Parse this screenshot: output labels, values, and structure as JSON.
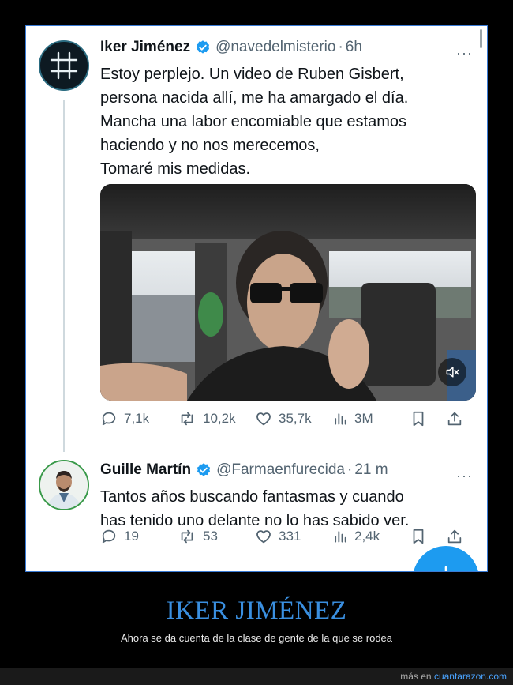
{
  "tweets": [
    {
      "name": "Iker Jiménez",
      "handle": "@navedelmisterio",
      "separator": "·",
      "time": "6h",
      "more": "···",
      "text": "Estoy perplejo. Un video de Ruben Gisbert,\npersona nacida allí,  me ha amargado el día.\nMancha una labor encomiable que estamos\nhaciendo y no nos merecemos,\nTomaré mis medidas.",
      "replies": "7,1k",
      "retweets": "10,2k",
      "likes": "35,7k",
      "views": "3M"
    },
    {
      "name": "Guille Martín",
      "handle": "@Farmaenfurecida",
      "separator": "·",
      "time": "21 m",
      "more": "···",
      "text": "Tantos años buscando fantasmas y cuando\nhas tenido uno delante no lo has sabido ver.",
      "replies": "19",
      "retweets": "53",
      "likes": "331",
      "views": "2,4k"
    }
  ],
  "caption": {
    "title": "IKER JIMÉNEZ",
    "subtitle": "Ahora se da cuenta de la clase de gente de la que se rodea"
  },
  "footer": {
    "prefix": "más en ",
    "site": "cuantarazon.com"
  },
  "colors": {
    "accent": "#1d9bf0",
    "caption_title": "#3a8fe0",
    "muted_text": "#536471"
  }
}
